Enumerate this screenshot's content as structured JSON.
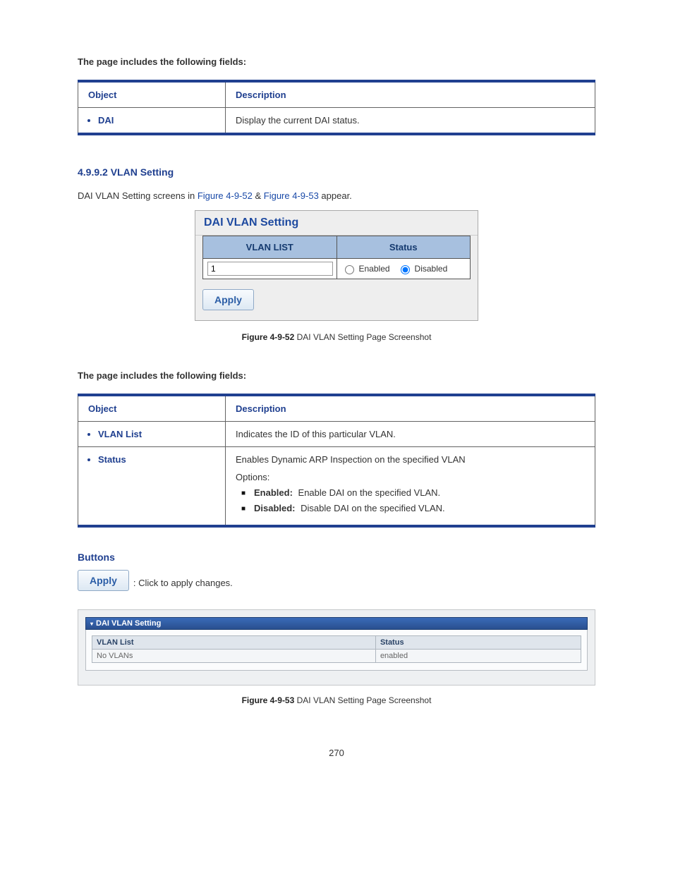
{
  "intro1": "The page includes the following fields:",
  "table1": {
    "head_object": "Object",
    "head_desc": "Description",
    "row1_obj": "DAI",
    "row1_desc": "Display the current DAI status."
  },
  "section_heading": "4.9.9.2 VLAN Setting",
  "sentence": {
    "pre": "DAI VLAN Setting screens in ",
    "link1": "Figure 4-9-52",
    "mid": " & ",
    "link2": "Figure 4-9-53",
    "post": " appear."
  },
  "panel1": {
    "title": "DAI VLAN Setting",
    "col_vlan": "VLAN LIST",
    "col_status": "Status",
    "vlan_value": "1",
    "enabled_label": "Enabled",
    "disabled_label": "Disabled",
    "apply": "Apply"
  },
  "caption1_pre": "Figure 4-9-52 ",
  "caption1": "DAI VLAN Setting Page Screenshot",
  "intro2": "The page includes the following fields:",
  "table2": {
    "head_object": "Object",
    "head_desc": "Description",
    "row1_obj": "VLAN List",
    "row1_desc": "Indicates the ID of this particular VLAN.",
    "row2_obj": "Status",
    "row2_line1": "Enables Dynamic ARP Inspection on the specified VLAN",
    "row2_line2": "Options:",
    "row2_opt1_name": "Enabled:",
    "row2_opt1_desc": " Enable DAI on the specified VLAN.",
    "row2_opt2_name": "Disabled:",
    "row2_opt2_desc": " Disable DAI on the specified VLAN."
  },
  "buttons_heading": "Buttons",
  "apply_inline": "Apply",
  "apply_desc": ": Click to apply changes.",
  "panel2": {
    "header": "DAI VLAN Setting",
    "col1": "VLAN List",
    "col2": "Status",
    "val1": "No VLANs",
    "val2": "enabled"
  },
  "caption2_pre": "Figure 4-9-53 ",
  "caption2": "DAI VLAN Setting Page Screenshot",
  "page_number": "270"
}
